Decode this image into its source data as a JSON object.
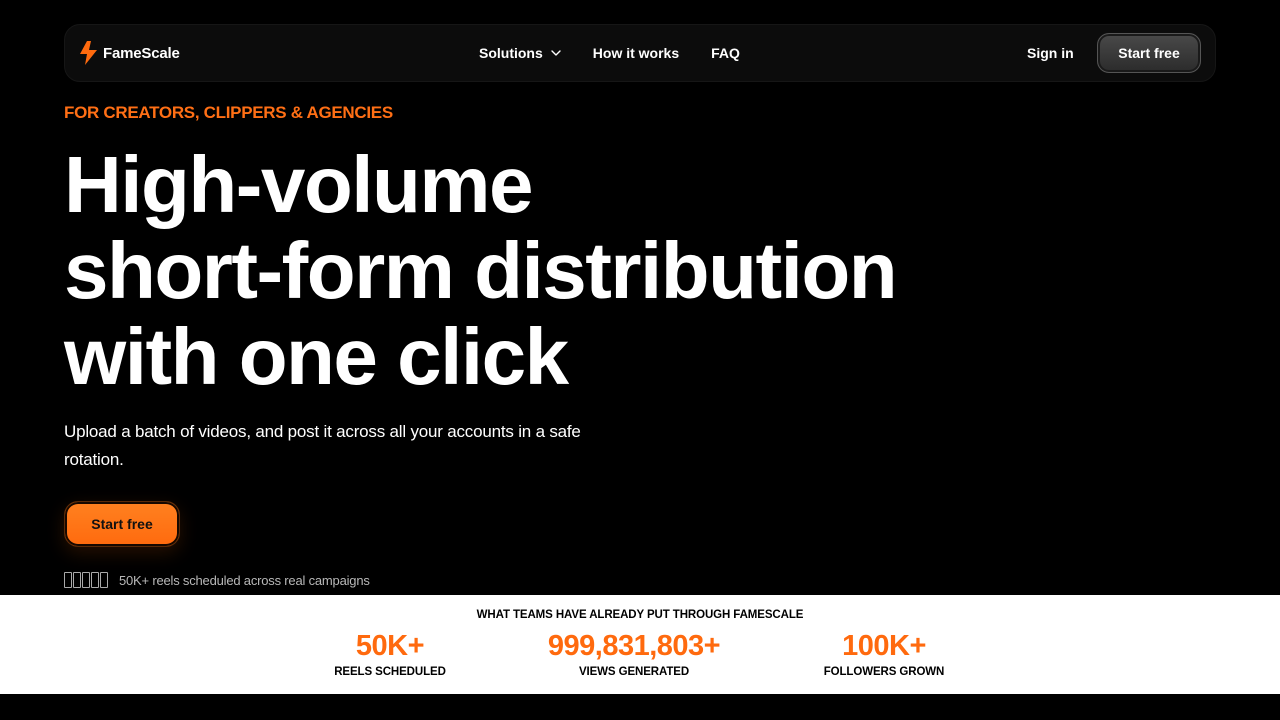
{
  "brand": {
    "name": "FameScale",
    "accent": "#ff6a0e"
  },
  "nav": {
    "links": [
      {
        "label": "Solutions"
      },
      {
        "label": "How it works"
      },
      {
        "label": "FAQ"
      }
    ],
    "signin": "Sign in",
    "cta": "Start free"
  },
  "hero": {
    "eyebrow": "FOR CREATORS, CLIPPERS & AGENCIES",
    "headline": [
      "High-volume",
      "short-form distribution",
      "with one click"
    ],
    "subtitle": "Upload a batch of videos, and post it across all your accounts in a safe rotation.",
    "cta": "Start free",
    "proof": "50K+ reels scheduled across real campaigns"
  },
  "stats": {
    "heading": "WHAT TEAMS HAVE ALREADY PUT THROUGH FAMESCALE",
    "items": [
      {
        "value": "50K+",
        "label": "REELS SCHEDULED"
      },
      {
        "value": "999,831,803+",
        "label": "VIEWS GENERATED"
      },
      {
        "value": "100K+",
        "label": "FOLLOWERS GROWN"
      }
    ]
  }
}
